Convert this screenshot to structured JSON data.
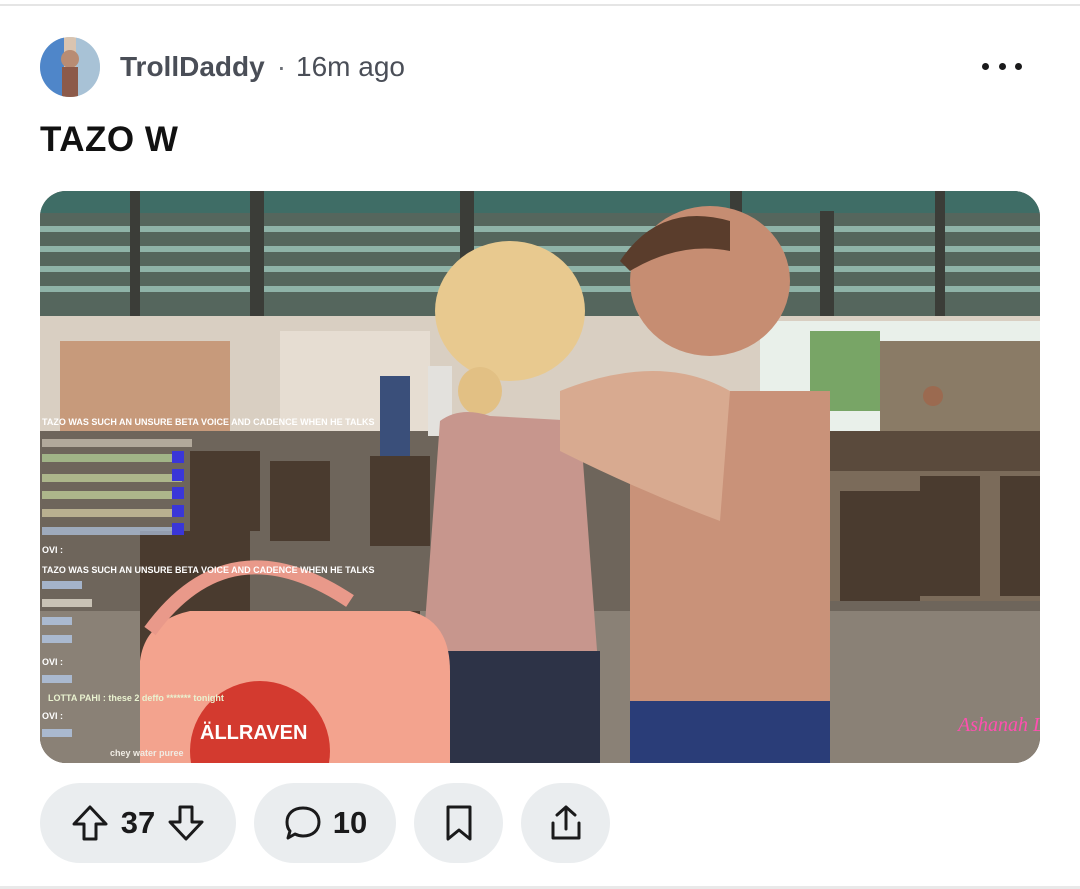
{
  "post": {
    "author": "TrollDaddy",
    "separator": "·",
    "time_ago": "16m ago",
    "title": "TAZO W"
  },
  "media": {
    "overlay_text": {
      "chat_line_1": "TAZO WAS SUCH AN UNSURE BETA VOICE AND CADENCE WHEN HE TALKS",
      "chat_line_2": "TAZO WAS SUCH AN UNSURE BETA VOICE AND CADENCE WHEN HE TALKS",
      "chat_user_1": "OVI :",
      "chat_user_2": "OVI :",
      "chat_user_3": "OVI :",
      "chat_msg": "LOTTA PAHI : these 2 deffo ******* tonight",
      "chat_msg_2": "chey water puree",
      "watermark": "Ashanah Lee",
      "bag_text": "ÄLLRAVEN"
    }
  },
  "actions": {
    "upvotes": "37",
    "comments": "10"
  },
  "icons": {
    "more": "more-options-icon",
    "upvote": "arrow-up-icon",
    "downvote": "arrow-down-icon",
    "comment": "comment-bubble-icon",
    "save": "bookmark-icon",
    "share": "share-icon"
  }
}
